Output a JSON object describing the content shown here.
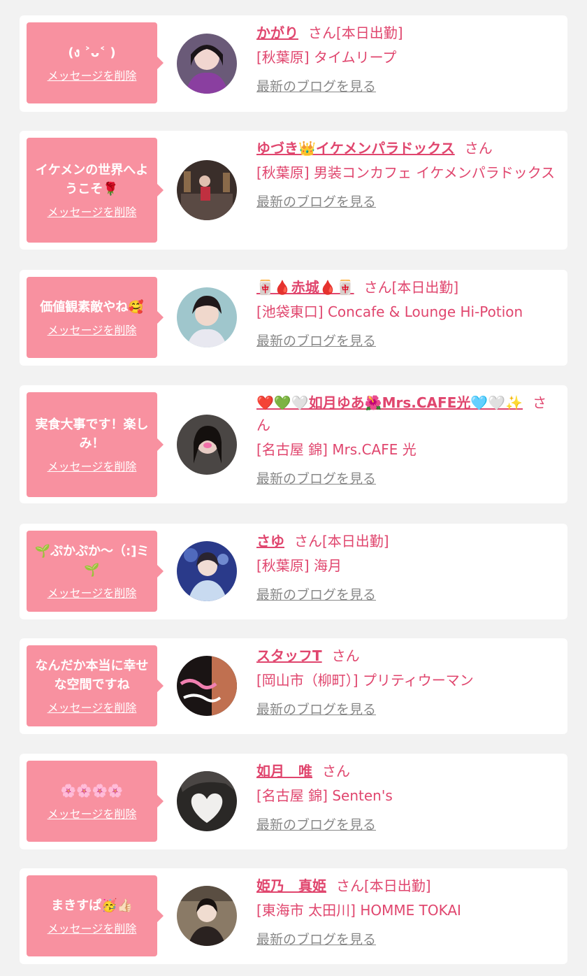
{
  "delete_label": "メッセージを削除",
  "blog_label": "最新のブログを見る",
  "colors": {
    "page_bg": "#f2f2f2",
    "card_bg": "#ffffff",
    "bubble_bg": "#f891a0",
    "accent": "#e0466e",
    "muted": "#888888"
  },
  "messages": [
    {
      "bubble_text": "(ง ˃ᴗ˂ )",
      "name": "かがり",
      "suffix": "さん[本日出勤]",
      "shop": "[秋葉原] タイムリープ"
    },
    {
      "bubble_text": "イケメンの世界へようこそ🌹",
      "name": "ゆづき👑イケメンパラドックス",
      "suffix": "さん",
      "shop": "[秋葉原] 男装コンカフェ イケメンパラドックス"
    },
    {
      "bubble_text": "価値観素敵やね🥰",
      "name": "🀄🩸赤城🩸🀄",
      "suffix": "さん[本日出勤]",
      "shop": "[池袋東口] Concafe & Lounge Hi-Potion"
    },
    {
      "bubble_text": "実食大事です！楽しみ！",
      "name": "❤️💚🤍如月ゆあ🌺Mrs.CAFE光🩵🤍✨",
      "suffix": "さん",
      "shop": "[名古屋 錦] Mrs.CAFE 光"
    },
    {
      "bubble_text": "🌱ぷかぷか〜（:]ミ🌱",
      "name": "さゆ",
      "suffix": "さん[本日出勤]",
      "shop": "[秋葉原] 海月"
    },
    {
      "bubble_text": "なんだか本当に幸せな空間ですね",
      "name": "スタッフT",
      "suffix": "さん",
      "shop": "[岡山市（柳町）] プリティウーマン"
    },
    {
      "bubble_text": "🌸🌸🌸🌸",
      "name": "如月　唯",
      "suffix": "さん",
      "shop": "[名古屋 錦] Senten's"
    },
    {
      "bubble_text": "まきすぱ🥳👍🏻",
      "name": "姫乃　真姫",
      "suffix": "さん[本日出勤]",
      "shop": "[東海市 太田川] HOMME TOKAI"
    }
  ]
}
